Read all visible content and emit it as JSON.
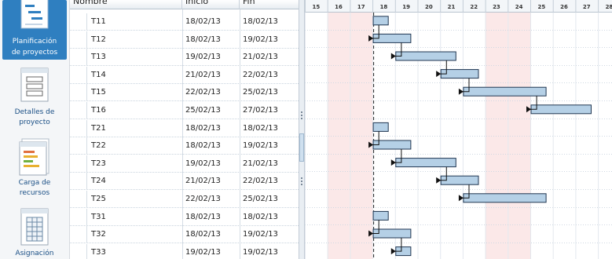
{
  "nav": [
    {
      "name": "planificacion",
      "line1": "Planificación",
      "line2": "de proyectos",
      "active": true
    },
    {
      "name": "detalles",
      "line1": "Detalles de",
      "line2": "proyecto",
      "active": false
    },
    {
      "name": "carga",
      "line1": "Carga de",
      "line2": "recursos",
      "active": false
    },
    {
      "name": "asignacion",
      "line1": "Asignación",
      "line2": "",
      "active": false
    }
  ],
  "grid": {
    "headers": {
      "name": "Nombre",
      "start": "Inicio",
      "end": "Fin"
    },
    "rows": [
      {
        "name": "T11",
        "start": "18/02/13",
        "end": "18/02/13"
      },
      {
        "name": "T12",
        "start": "18/02/13",
        "end": "19/02/13"
      },
      {
        "name": "T13",
        "start": "19/02/13",
        "end": "21/02/13"
      },
      {
        "name": "T14",
        "start": "21/02/13",
        "end": "22/02/13"
      },
      {
        "name": "T15",
        "start": "22/02/13",
        "end": "25/02/13"
      },
      {
        "name": "T16",
        "start": "25/02/13",
        "end": "27/02/13"
      },
      {
        "name": "T21",
        "start": "18/02/13",
        "end": "18/02/13"
      },
      {
        "name": "T22",
        "start": "18/02/13",
        "end": "19/02/13"
      },
      {
        "name": "T23",
        "start": "19/02/13",
        "end": "21/02/13"
      },
      {
        "name": "T24",
        "start": "21/02/13",
        "end": "22/02/13"
      },
      {
        "name": "T25",
        "start": "22/02/13",
        "end": "25/02/13"
      },
      {
        "name": "T31",
        "start": "18/02/13",
        "end": "18/02/13"
      },
      {
        "name": "T32",
        "start": "18/02/13",
        "end": "19/02/13"
      },
      {
        "name": "T33",
        "start": "19/02/13",
        "end": "19/02/13"
      }
    ]
  },
  "timeline": {
    "days": [
      "15",
      "16",
      "17",
      "18",
      "19",
      "20",
      "21",
      "22",
      "23",
      "24",
      "25",
      "26",
      "27",
      "28"
    ],
    "weekend_days": [
      "16",
      "17",
      "23",
      "24"
    ],
    "today_day": "18",
    "colors": {
      "weekend": "#fbe8e8",
      "bar_fill": "#b5d0e6",
      "bar_border": "#1f3550",
      "accent": "#2f7fc0"
    }
  }
}
